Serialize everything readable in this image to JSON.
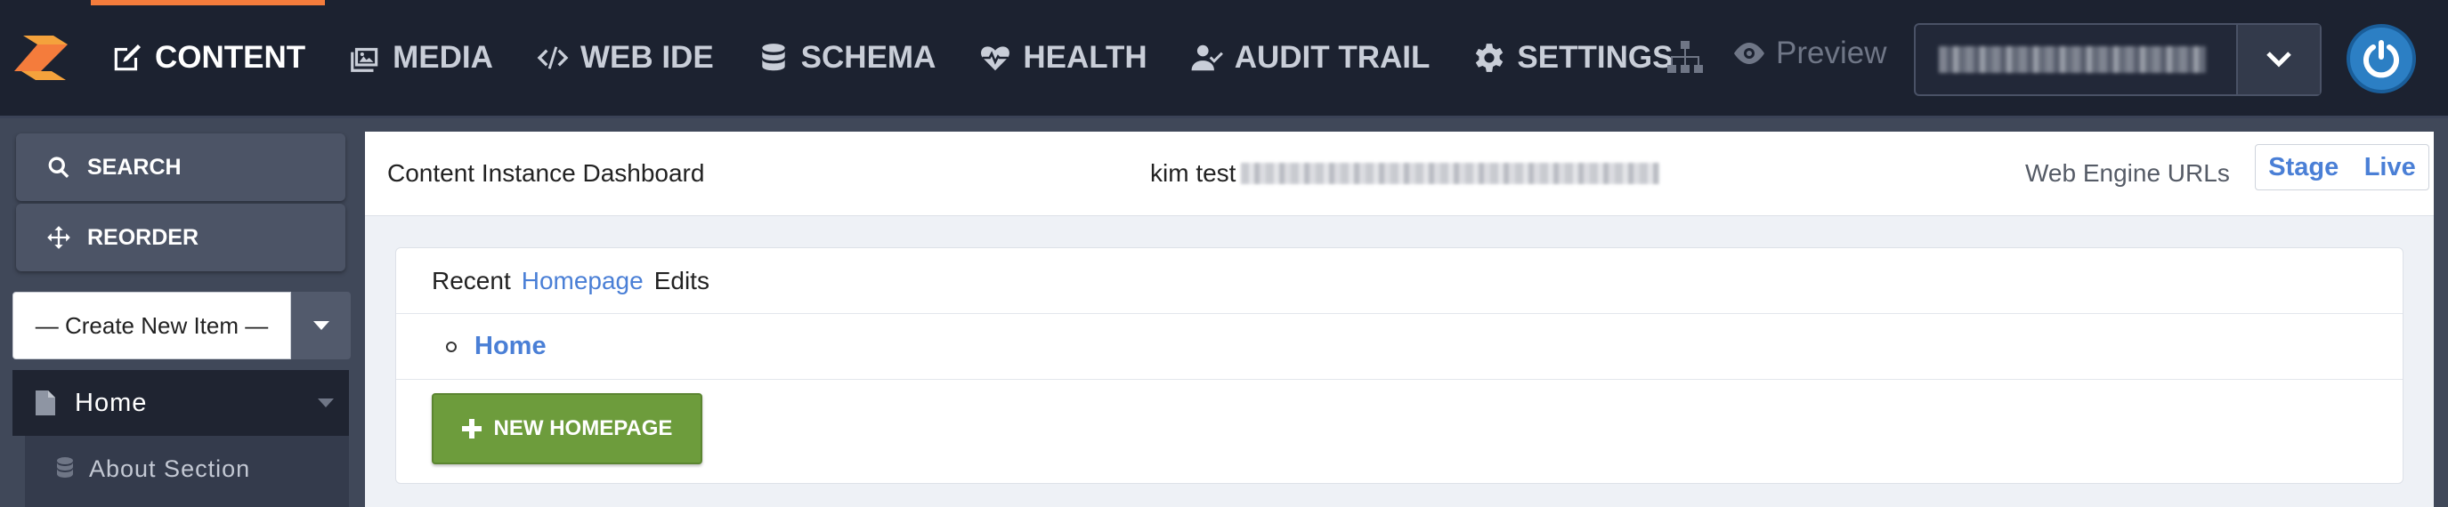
{
  "nav": {
    "items": [
      {
        "label": "CONTENT",
        "icon": "edit-icon",
        "active": true
      },
      {
        "label": "MEDIA",
        "icon": "images-icon",
        "active": false
      },
      {
        "label": "WEB IDE",
        "icon": "code-icon",
        "active": false
      },
      {
        "label": "SCHEMA",
        "icon": "database-icon",
        "active": false
      },
      {
        "label": "HEALTH",
        "icon": "heartbeat-icon",
        "active": false
      },
      {
        "label": "AUDIT TRAIL",
        "icon": "user-check-icon",
        "active": false
      },
      {
        "label": "SETTINGS",
        "icon": "gear-icon",
        "active": false
      }
    ],
    "preview_label": "Preview",
    "accent_color": "#f47c3c"
  },
  "sidebar": {
    "search_label": "SEARCH",
    "reorder_label": "REORDER",
    "create_select_value": "— Create New Item —",
    "tree": [
      {
        "label": "Home",
        "icon": "file-icon"
      },
      {
        "label": "About Section",
        "icon": "database-icon"
      }
    ]
  },
  "header": {
    "dashboard_title": "Content Instance Dashboard",
    "instance_name_prefix": "kim test",
    "web_engine_label": "Web Engine URLs",
    "stage_label": "Stage",
    "live_label": "Live"
  },
  "recent": {
    "title_prefix": "Recent",
    "title_highlight": "Homepage",
    "title_suffix": "Edits",
    "items": [
      "Home"
    ],
    "new_button_label": "NEW HOMEPAGE",
    "button_color": "#6d9c3c",
    "link_color": "#4a7fd6"
  }
}
